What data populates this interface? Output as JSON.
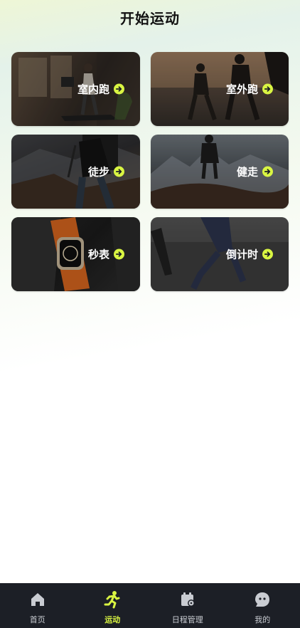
{
  "header": {
    "title": "开始运动"
  },
  "sports": [
    {
      "label": "室内跑",
      "scene": "treadmill"
    },
    {
      "label": "室外跑",
      "scene": "outdoor-run"
    },
    {
      "label": "徒步",
      "scene": "hiking"
    },
    {
      "label": "健走",
      "scene": "walking"
    },
    {
      "label": "秒表",
      "scene": "watch"
    },
    {
      "label": "倒计时",
      "scene": "countdown"
    }
  ],
  "tabbar": {
    "items": [
      {
        "label": "首页",
        "icon": "home-icon"
      },
      {
        "label": "运动",
        "icon": "running-icon",
        "active": true
      },
      {
        "label": "日程管理",
        "icon": "schedule-icon"
      },
      {
        "label": "我的",
        "icon": "profile-icon"
      }
    ]
  },
  "colors": {
    "accent": "#d9f542",
    "tabbar_bg": "#1c1f26"
  }
}
